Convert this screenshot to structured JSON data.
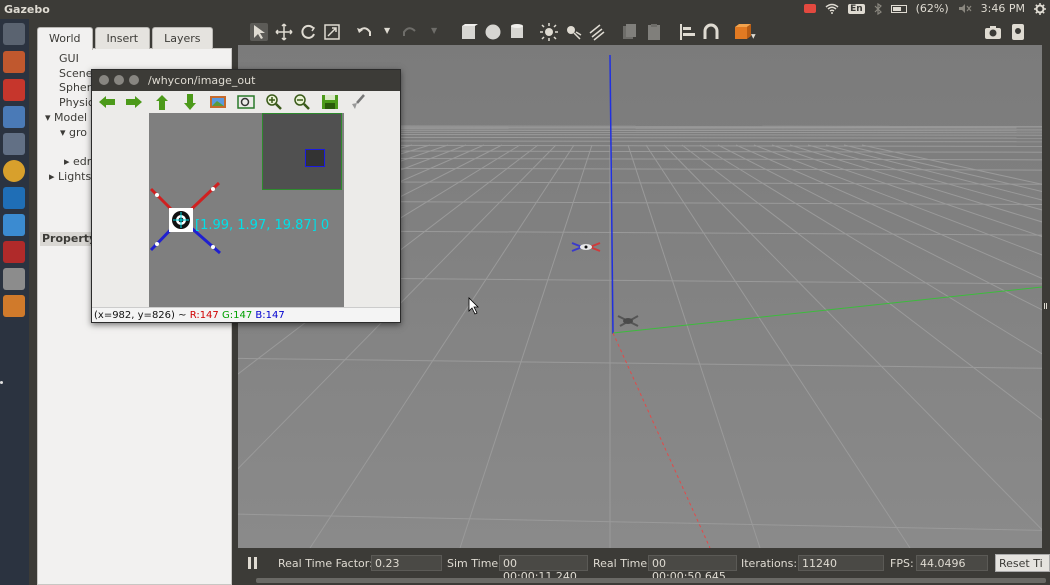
{
  "app": {
    "title": "Gazebo"
  },
  "tray": {
    "lang": "En",
    "battery": "(62%)",
    "clock": "3:46 PM"
  },
  "left_panel": {
    "tabs": [
      "World",
      "Insert",
      "Layers"
    ],
    "tree": [
      "GUI",
      "Scene",
      "Spher",
      "Physic",
      "Model",
      "gro",
      "edr",
      "Lights"
    ],
    "property_header": "Property"
  },
  "image_window": {
    "title": "/whycon/image_out",
    "overlay_text": "[1.99, 1.97, 19.87] 0",
    "status": {
      "coords": "(x=982, y=826) ~",
      "r": "R:147",
      "g": "G:147",
      "b": "B:147"
    }
  },
  "statusbar": {
    "rtf_label": "Real Time Factor:",
    "rtf_value": "0.23",
    "sim_label": "Sim Time:",
    "sim_value": "00 00:00:11.240",
    "real_label": "Real Time:",
    "real_value": "00 00:00:50.645",
    "iter_label": "Iterations:",
    "iter_value": "11240",
    "fps_label": "FPS:",
    "fps_value": "44.0496",
    "reset_label": "Reset Ti"
  },
  "colors": {
    "axis_x": "#e24a4a",
    "axis_y": "#3cbc3c",
    "axis_z": "#2030e0",
    "status_r": "#d00000",
    "status_g": "#00a000",
    "status_b": "#0000d0",
    "overlay_text": "#00e0e8"
  }
}
